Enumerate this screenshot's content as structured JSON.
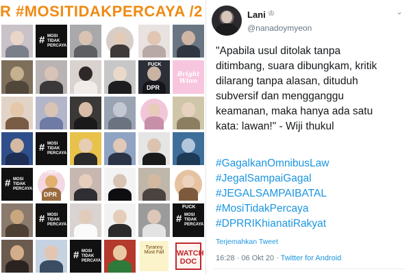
{
  "left": {
    "title": "R #MOSITIDAKPERCAYA /2",
    "tiles": [
      {
        "kind": "photo",
        "bg": "#c9c2c8",
        "head": "#e8d7c9",
        "body": "#7a7f8a"
      },
      {
        "kind": "mosi",
        "hash": "#",
        "line1": "MOSI",
        "line2": "TIDAK",
        "line3": "PERCAYA"
      },
      {
        "kind": "photo",
        "bg": "#a9a9ab",
        "head": "#d9c3b2",
        "body": "#5d5f63"
      },
      {
        "kind": "photo-circle",
        "bg": "#d7cfc7",
        "head": "#e3cbb6",
        "body": "#3f3a3a"
      },
      {
        "kind": "photo",
        "bg": "#e8e3e0",
        "head": "#e1c6b3",
        "body": "#b9a9a6"
      },
      {
        "kind": "photo",
        "bg": "#6a7584",
        "head": "#d1b5a4",
        "body": "#2f3641"
      },
      {
        "kind": "photo",
        "bg": "#7e6f5b",
        "head": "#c5b08f",
        "body": "#51463a"
      },
      {
        "kind": "photo",
        "bg": "#b9b4b3",
        "head": "#d8c4b7",
        "body": "#3a3838"
      },
      {
        "kind": "photo",
        "bg": "#d9d2cf",
        "head": "#2e2828",
        "body": "#f1ece9"
      },
      {
        "kind": "photo",
        "bg": "#c7c7c7",
        "head": "#ead8ca",
        "body": "#1d1d1f"
      },
      {
        "kind": "photo-tag",
        "bg": "#2c2f38",
        "head": "#c9b3a2",
        "body": "#151619",
        "top": "FUCK",
        "bottom": "DPR"
      },
      {
        "kind": "bright",
        "line1": "Bright",
        "line2": "Winn"
      },
      {
        "kind": "photo",
        "bg": "#e2d3c7",
        "head": "#e5c7a9",
        "body": "#7a5b44"
      },
      {
        "kind": "photo",
        "bg": "#b3b6c9",
        "head": "#d8c3b4",
        "body": "#6f7aa5"
      },
      {
        "kind": "photo",
        "bg": "#3b3937",
        "head": "#d8bca8",
        "body": "#1b1a1a"
      },
      {
        "kind": "photo",
        "bg": "#9aa3b2",
        "head": "#c4c8d2",
        "body": "#6b7280"
      },
      {
        "kind": "photo-circle",
        "bg": "#f2c6d9",
        "head": "#e8cbb8",
        "body": "#c88fa9"
      },
      {
        "kind": "photo",
        "bg": "#cfc6a9",
        "head": "#e7d2bf",
        "body": "#8c7f61"
      },
      {
        "kind": "photo",
        "bg": "#2e4f8a",
        "head": "#d4b9a3",
        "body": "#1f2e55"
      },
      {
        "kind": "mosi",
        "hash": "#",
        "line1": "MOSI",
        "line2": "TIDAK",
        "line3": "PERCAYA"
      },
      {
        "kind": "photo",
        "bg": "#e8c24a",
        "head": "#e7cdb4",
        "body": "#2b2a2a"
      },
      {
        "kind": "photo",
        "bg": "#8fa3c2",
        "head": "#e1c9b6",
        "body": "#2c3448"
      },
      {
        "kind": "photo",
        "bg": "#e5e5e5",
        "head": "#dcc3af",
        "body": "#1a1a1a"
      },
      {
        "kind": "photo",
        "bg": "#3e6f9a",
        "head": "#b3c7db",
        "body": "#1d3a57"
      },
      {
        "kind": "mosi",
        "hash": "#",
        "line1": "MOSI",
        "line2": "TIDAK",
        "line3": "PERCAYA"
      },
      {
        "kind": "photo-circle-tag",
        "bg": "#f3d8e3",
        "head": "#e2b06f",
        "body": "#9a6b3e",
        "top": "FUCK",
        "bottom": "DPR"
      },
      {
        "kind": "photo",
        "bg": "#c6b7b0",
        "head": "#e5cebd",
        "body": "#2e2e33"
      },
      {
        "kind": "photo",
        "bg": "#f3f3f3",
        "head": "#d9c4b4",
        "body": "#0e0e10"
      },
      {
        "kind": "photo",
        "bg": "#bfb7aa",
        "head": "#d4b9a1",
        "body": "#4a4340"
      },
      {
        "kind": "photo-circle",
        "bg": "#e5c3a1",
        "head": "#edd3bd",
        "body": "#7e5a3c"
      },
      {
        "kind": "photo",
        "bg": "#8a7a6d",
        "head": "#c8a77f",
        "body": "#4d3f33"
      },
      {
        "kind": "mosi",
        "hash": "#",
        "line1": "MOSI",
        "line2": "TIDAK",
        "line3": "PERCAYA"
      },
      {
        "kind": "photo",
        "bg": "#d9d3d1",
        "head": "#e1cbbb",
        "body": "#fafafa"
      },
      {
        "kind": "photo",
        "bg": "#f2f2f2",
        "head": "#e5cdb9",
        "body": "#2b2b2b"
      },
      {
        "kind": "photo",
        "bg": "#9b9b9b",
        "head": "#dcc7b8",
        "body": "#e3e3e3"
      },
      {
        "kind": "mosi-tag",
        "top": "FUCK",
        "hash": "#",
        "line1": "MOSI",
        "line2": "TIDAK",
        "line3": "PERCAYA"
      },
      {
        "kind": "photo",
        "bg": "#6b5a4e",
        "head": "#d4ad8b",
        "body": "#2a2320"
      },
      {
        "kind": "photo",
        "bg": "#c4d2e2",
        "head": "#e2c6b1",
        "body": "#3a4d63"
      },
      {
        "kind": "mosi",
        "hash": "#",
        "line1": "MOSI",
        "line2": "TIDAK",
        "line3": "PERCAYA"
      },
      {
        "kind": "photo",
        "bg": "#b33a2d",
        "head": "#e9c9a3",
        "body": "#2e7a3a"
      },
      {
        "kind": "sticker",
        "line1": "Tyranny",
        "line2": "Must Fall"
      },
      {
        "kind": "watch",
        "line1": "WATCH",
        "line2": "DOC"
      }
    ]
  },
  "tweet": {
    "display_name": "Lani",
    "badge_icon": "crown-icon",
    "handle": "@nanadoymyeon",
    "quote_lines": [
      "\"Apabila usul ditolak tanpa",
      "ditimbang, suara dibungkam, kritik",
      "dilarang tanpa alasan, dituduh",
      "subversif dan mengganggu",
      "keamanan, maka hanya ada satu",
      "kata: lawan!\" - Wiji thukul"
    ],
    "hashtags": [
      "#GagalkanOmnibusLaw",
      "#JegalSampaiGagal",
      "#JEGALSAMPAIBATAL",
      "#MosiTidakPercaya",
      "#DPRRIKhianatiRakyat"
    ],
    "translate": "Terjemahkan Tweet",
    "time": "16:28",
    "dot": "·",
    "date": "06 Okt 20",
    "client": "Twitter for Android",
    "link_color": "#1b95e0",
    "title_color": "#f08a12"
  }
}
